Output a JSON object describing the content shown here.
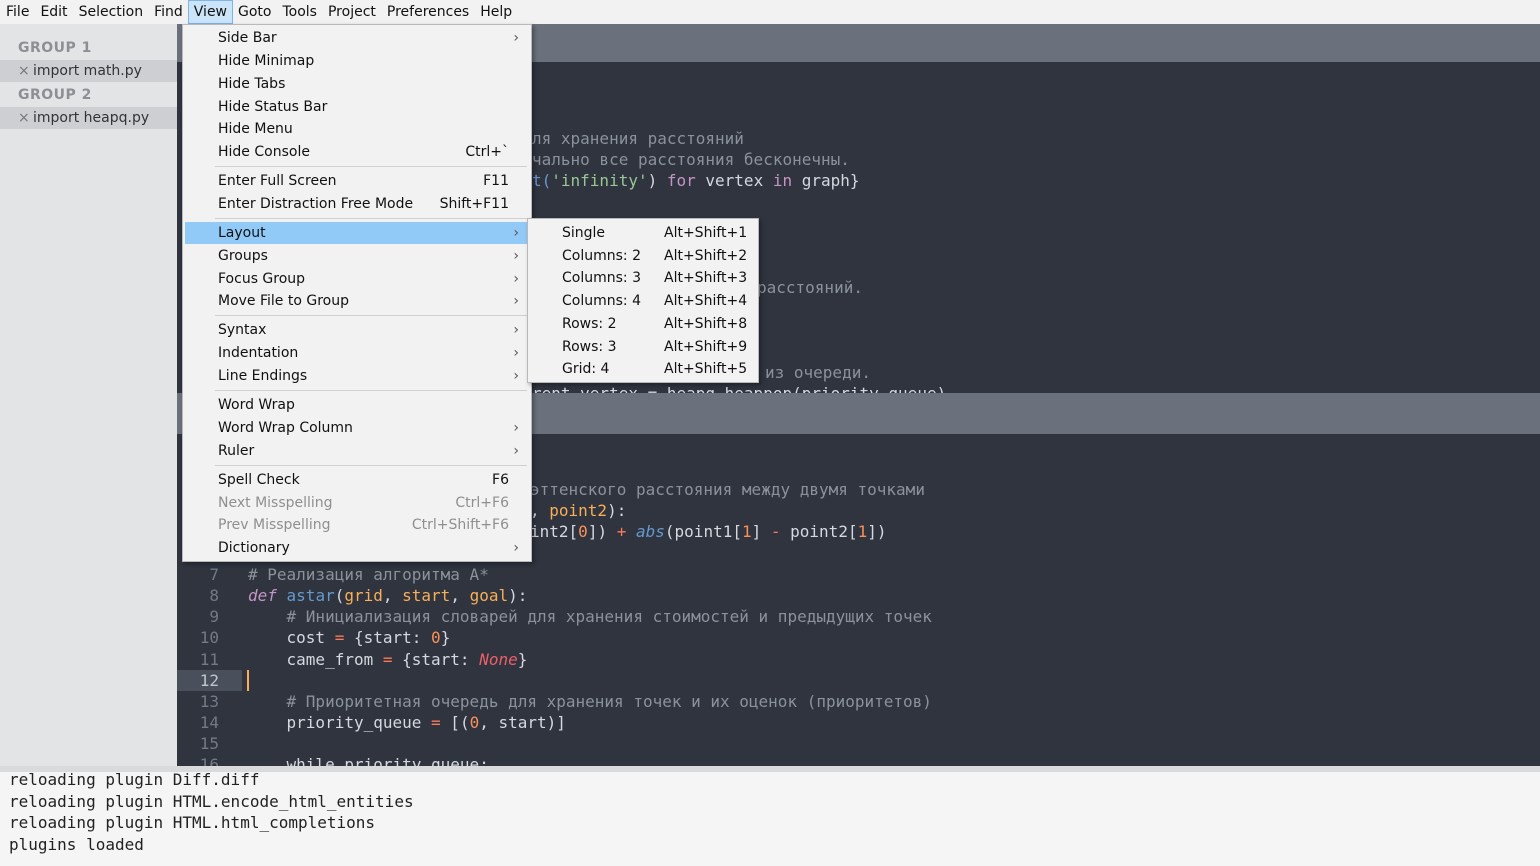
{
  "menubar": [
    "File",
    "Edit",
    "Selection",
    "Find",
    "View",
    "Goto",
    "Tools",
    "Project",
    "Preferences",
    "Help"
  ],
  "menubar_active": "View",
  "sidebar": {
    "groups": [
      {
        "title": "GROUP 1",
        "file": "import math.py"
      },
      {
        "title": "GROUP 2",
        "file": "import heapq.py"
      }
    ],
    "close_glyph": "×"
  },
  "view_menu": {
    "sections": [
      [
        {
          "label": "Side Bar",
          "submenu": true
        },
        {
          "label": "Hide Minimap"
        },
        {
          "label": "Hide Tabs"
        },
        {
          "label": "Hide Status Bar"
        },
        {
          "label": "Hide Menu"
        },
        {
          "label": "Hide Console",
          "shortcut": "Ctrl+`"
        }
      ],
      [
        {
          "label": "Enter Full Screen",
          "shortcut": "F11"
        },
        {
          "label": "Enter Distraction Free Mode",
          "shortcut": "Shift+F11"
        }
      ],
      [
        {
          "label": "Layout",
          "submenu": true,
          "highlighted": true
        },
        {
          "label": "Groups",
          "submenu": true
        },
        {
          "label": "Focus Group",
          "submenu": true
        },
        {
          "label": "Move File to Group",
          "submenu": true
        }
      ],
      [
        {
          "label": "Syntax",
          "submenu": true
        },
        {
          "label": "Indentation",
          "submenu": true
        },
        {
          "label": "Line Endings",
          "submenu": true
        }
      ],
      [
        {
          "label": "Word Wrap"
        },
        {
          "label": "Word Wrap Column",
          "submenu": true
        },
        {
          "label": "Ruler",
          "submenu": true
        }
      ],
      [
        {
          "label": "Spell Check",
          "shortcut": "F6"
        },
        {
          "label": "Next Misspelling",
          "shortcut": "Ctrl+F6",
          "disabled": true
        },
        {
          "label": "Prev Misspelling",
          "shortcut": "Ctrl+Shift+F6",
          "disabled": true
        },
        {
          "label": "Dictionary",
          "submenu": true
        }
      ]
    ],
    "arrow_glyph": "›"
  },
  "layout_submenu": [
    {
      "label": "Single",
      "shortcut": "Alt+Shift+1"
    },
    {
      "label": "Columns: 2",
      "shortcut": "Alt+Shift+2"
    },
    {
      "label": "Columns: 3",
      "shortcut": "Alt+Shift+3"
    },
    {
      "label": "Columns: 4",
      "shortcut": "Alt+Shift+4"
    },
    {
      "label": "Rows: 2",
      "shortcut": "Alt+Shift+8"
    },
    {
      "label": "Rows: 3",
      "shortcut": "Alt+Shift+9"
    },
    {
      "label": "Grid: 4",
      "shortcut": "Alt+Shift+5"
    }
  ],
  "pane1_fragments": {
    "l1": "ля хранения расстояний",
    "l2": "чально все расстояния бесконечны.",
    "l3a": "t(",
    "l3b": "'infinity'",
    "l3c": ") ",
    "l3d": "for",
    "l3e": " vertex ",
    "l3f": "in",
    "l3g": " graph}",
    "l4": "расстояний.",
    "l5": "из очереди.",
    "l6": "rent_vertex = heapq.heappop(priority_queue)"
  },
  "pane2_fragments": {
    "l1": "эттенского расстояния между двумя точками",
    "l2a": ", ",
    "l2b": "point2",
    "l2c": "):",
    "l3a": "int2[",
    "l3b": "0",
    "l3c": "]) ",
    "l3d": "+",
    "l3e": " ",
    "l3f": "abs",
    "l3g": "(point1[",
    "l3h": "1",
    "l3i": "] ",
    "l3j": "-",
    "l3k": " point2[",
    "l3l": "1",
    "l3m": "])"
  },
  "code_lines": {
    "n7": "7",
    "n8": "8",
    "n9": "9",
    "n10": "10",
    "n11": "11",
    "n12": "12",
    "n13": "13",
    "n14": "14",
    "n15": "15",
    "n16": "16",
    "l7": "# Реализация алгоритма A*",
    "l8_def": "def",
    "l8_fn": " astar",
    "l8_p1": "(",
    "l8_a": "grid",
    "l8_c1": ", ",
    "l8_b": "start",
    "l8_c2": ", ",
    "l8_g": "goal",
    "l8_end": "):",
    "l9": "    # Инициализация словарей для хранения стоимостей и предыдущих точек",
    "l10a": "    cost ",
    "l10b": "=",
    "l10c": " {start: ",
    "l10d": "0",
    "l10e": "}",
    "l11a": "    came_from ",
    "l11b": "=",
    "l11c": " {start: ",
    "l11d": "None",
    "l11e": "}",
    "l13": "    # Приоритетная очередь для хранения точек и их оценок (приоритетов)",
    "l14a": "    priority_queue ",
    "l14b": "=",
    "l14c": " [(",
    "l14d": "0",
    "l14e": ", start)]",
    "l16": "    while priority_queue:"
  },
  "console": [
    "reloading plugin Diff.diff",
    "reloading plugin HTML.encode_html_entities",
    "reloading plugin HTML.html_completions",
    "plugins loaded"
  ]
}
